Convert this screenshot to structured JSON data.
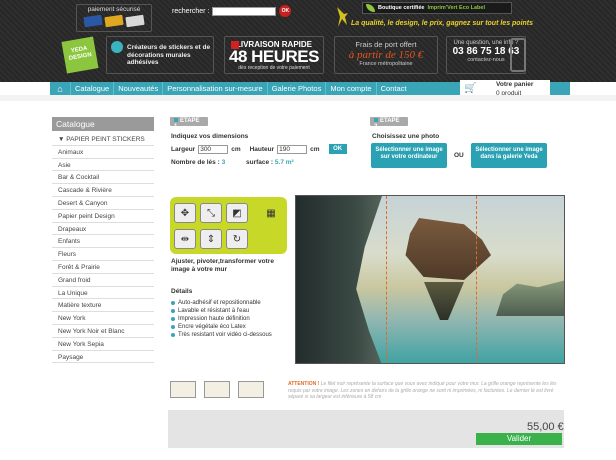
{
  "header": {
    "payment_label": "paiement sécurisé",
    "search": {
      "label": "rechercher :",
      "value": "",
      "button": "OK"
    },
    "certification": {
      "label": "Boutique certifiée",
      "label_green": "Imprim'Vert Eco Label"
    },
    "tagline": "La qualité, le design, le prix, gagnez sur tout les points",
    "logo_text": "YEDA DESIGN",
    "blocks": {
      "creators": "Créateurs de stickers et de décorations murales adhésives",
      "delivery": {
        "line1": "LIVRAISON RAPIDE",
        "line2": "48 HEURES",
        "line3": "dès reception de votre paiement"
      },
      "shipping": {
        "line1": "Frais de port offert",
        "line2": "à partir de 150 €",
        "line3": "France métropolitaine"
      },
      "contact": {
        "line1": "Une question, une info ?",
        "phone": "03 86 75 18 63",
        "line3": "contactez-nous"
      }
    }
  },
  "nav": {
    "items": [
      "Catalogue",
      "Nouveautés",
      "Personnalisation sur-mesure",
      "Galerie Photos",
      "Mon compte",
      "Contact"
    ]
  },
  "cart": {
    "title": "Votre panier",
    "count": "0 produit"
  },
  "sidebar": {
    "title": "Catalogue",
    "items": [
      "▼ PAPIER PEINT STICKERS",
      "Animaux",
      "Asie",
      "Bar & Cocktail",
      "Cascade & Rivière",
      "Desert & Canyon",
      "Papier peint Design",
      "Drapeaux",
      "Enfants",
      "Fleurs",
      "Forêt & Prairie",
      "Grand froid",
      "La Unique",
      "Matière texture",
      "New York",
      "New York Noir et Blanc",
      "New York Sepia",
      "Paysage"
    ]
  },
  "step1": {
    "badge": "ETAPE 1",
    "title": "Indiquez vos dimensions",
    "width_label": "Largeur",
    "width_value": "300",
    "unit": "cm",
    "height_label": "Hauteur",
    "height_value": "190",
    "ok": "OK",
    "strips_label": "Nombre de lés :",
    "strips_value": "3",
    "surface_label": "surface :",
    "surface_value": "5.7 m²"
  },
  "step2": {
    "badge": "ETAPE 2",
    "title": "Choisissez une photo",
    "btn_computer": "Sélectionner une image sur votre ordinateur",
    "or": "OU",
    "btn_gallery": "Sélectionner une image dans la galerie Yeda"
  },
  "tools": {
    "caption": "Ajuster, pivoter,transformer votre image à votre mur"
  },
  "details": {
    "title": "Détails",
    "items": [
      "Auto-adhésif et repositionnable",
      "Lavable et résistant à l'eau",
      "Impression haute définition",
      "Encre végétale éco Latex",
      "Très resistant voir vidéo ci-dessous"
    ]
  },
  "notice": {
    "label": "ATTENTION !",
    "text": "Le filet noir représente la surface que vous avez indiqué pour votre mur. La grille orange représente les lés requis par votre image. Les zones en dehors de la grille orange ne sont ni imprimées, ni facturées. Le dernier lé est livré séparé si sa largeur est inférieure à 58 cm"
  },
  "footer": {
    "price": "55,00 €",
    "validate": "Valider"
  },
  "colors": {
    "accent": "#3aa5b7",
    "green": "#8cc63f",
    "validate": "#3ab14a"
  }
}
